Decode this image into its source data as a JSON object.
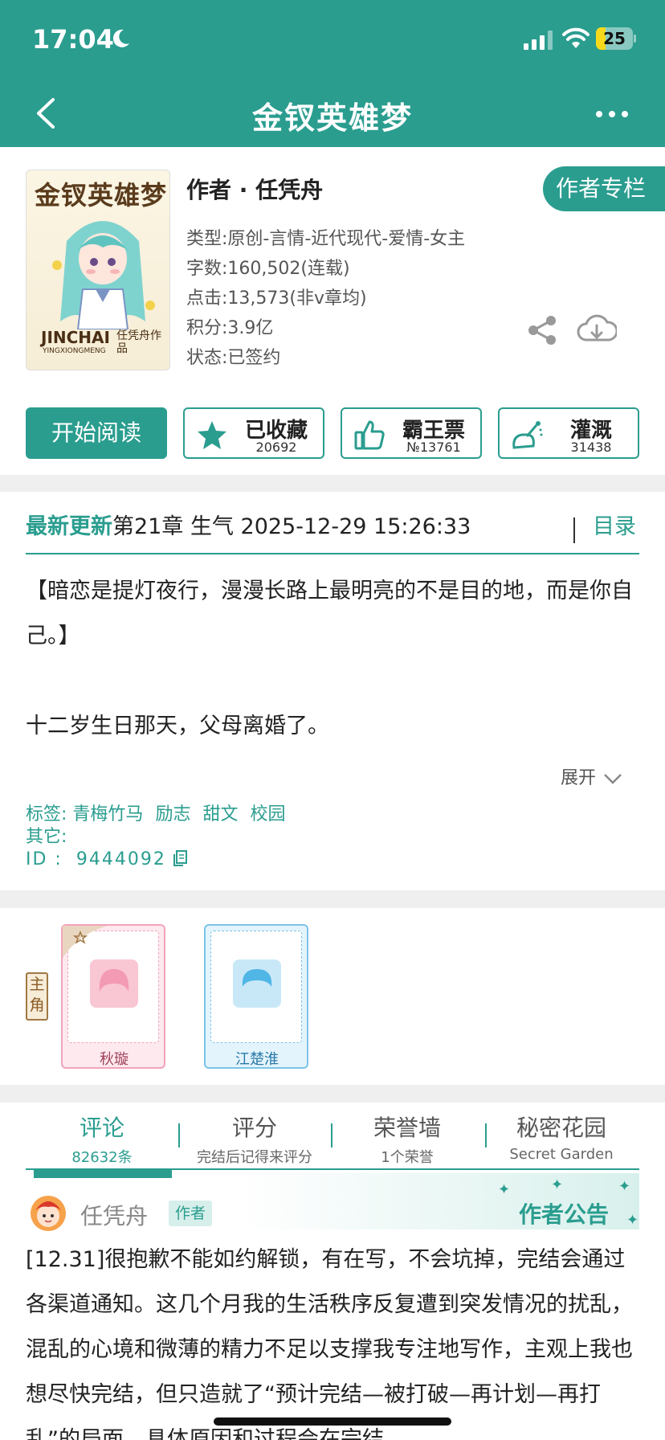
{
  "status_bar": {
    "time": "17:04",
    "battery_level": "25",
    "battery_fraction": 0.25
  },
  "nav": {
    "title": "金钗英雄梦"
  },
  "cover": {
    "title_art": "金钗英雄梦",
    "en_title": "JINCHAI",
    "en_subtitle": "YINGXIONGMENG",
    "author_art": "任凭舟作品"
  },
  "book": {
    "author_line": "作者 · 任凭舟",
    "author_column_button": "作者专栏",
    "info": [
      "类型:原创-言情-近代现代-爱情-女主",
      "字数:160,502(连载)",
      "点击:13,573(非v章均)",
      "积分:3.9亿",
      "状态:已签约"
    ]
  },
  "actions": {
    "read_label": "开始阅读",
    "collect": {
      "label": "已收藏",
      "count": "20692"
    },
    "tickets": {
      "label": "霸王票",
      "count": "№13761"
    },
    "water": {
      "label": "灌溉",
      "count": "31438"
    }
  },
  "update": {
    "label": "最新更新",
    "text": "第21章 生气 2025-12-29 15:26:33",
    "toc": "目录"
  },
  "summary": {
    "para1": "【暗恋是提灯夜行，漫漫长路上最明亮的不是目的地，而是你自己。】",
    "para2": "十二岁生日那天，父母离婚了。",
    "expand": "展开"
  },
  "tags": {
    "label": "标签:",
    "items": [
      "青梅竹马",
      "励志",
      "甜文",
      "校园"
    ],
    "other_label": "其它:",
    "id_label": "ID  :",
    "id_value": "9444092"
  },
  "characters": {
    "lead_tag": "主角",
    "list": [
      {
        "name": "秋璇"
      },
      {
        "name": "江楚淮"
      }
    ]
  },
  "tabs": [
    {
      "label": "评论",
      "sub": "82632条"
    },
    {
      "label": "评分",
      "sub": "完结后记得来评分"
    },
    {
      "label": "荣誉墙",
      "sub": "1个荣誉"
    },
    {
      "label": "秘密花园",
      "sub": "Secret Garden"
    }
  ],
  "comment": {
    "name": "任凭舟",
    "badge": "作者",
    "notice_label": "作者公告",
    "body": "[12.31]很抱歉不能如约解锁，有在写，不会坑掉，完结会通过各渠道通知。这几个月我的生活秩序反复遭到突发情况的扰乱，混乱的心境和微薄的精力不足以支撑我专注地写作，主观上我也想尽快完结，但只造就了“预计完结—被打破—再计划—再打乱”的局面，具体原因和过程会在完结"
  },
  "colors": {
    "accent": "#2a9d8f",
    "pink": "#f2a3bb",
    "blue": "#7cc4e8"
  }
}
